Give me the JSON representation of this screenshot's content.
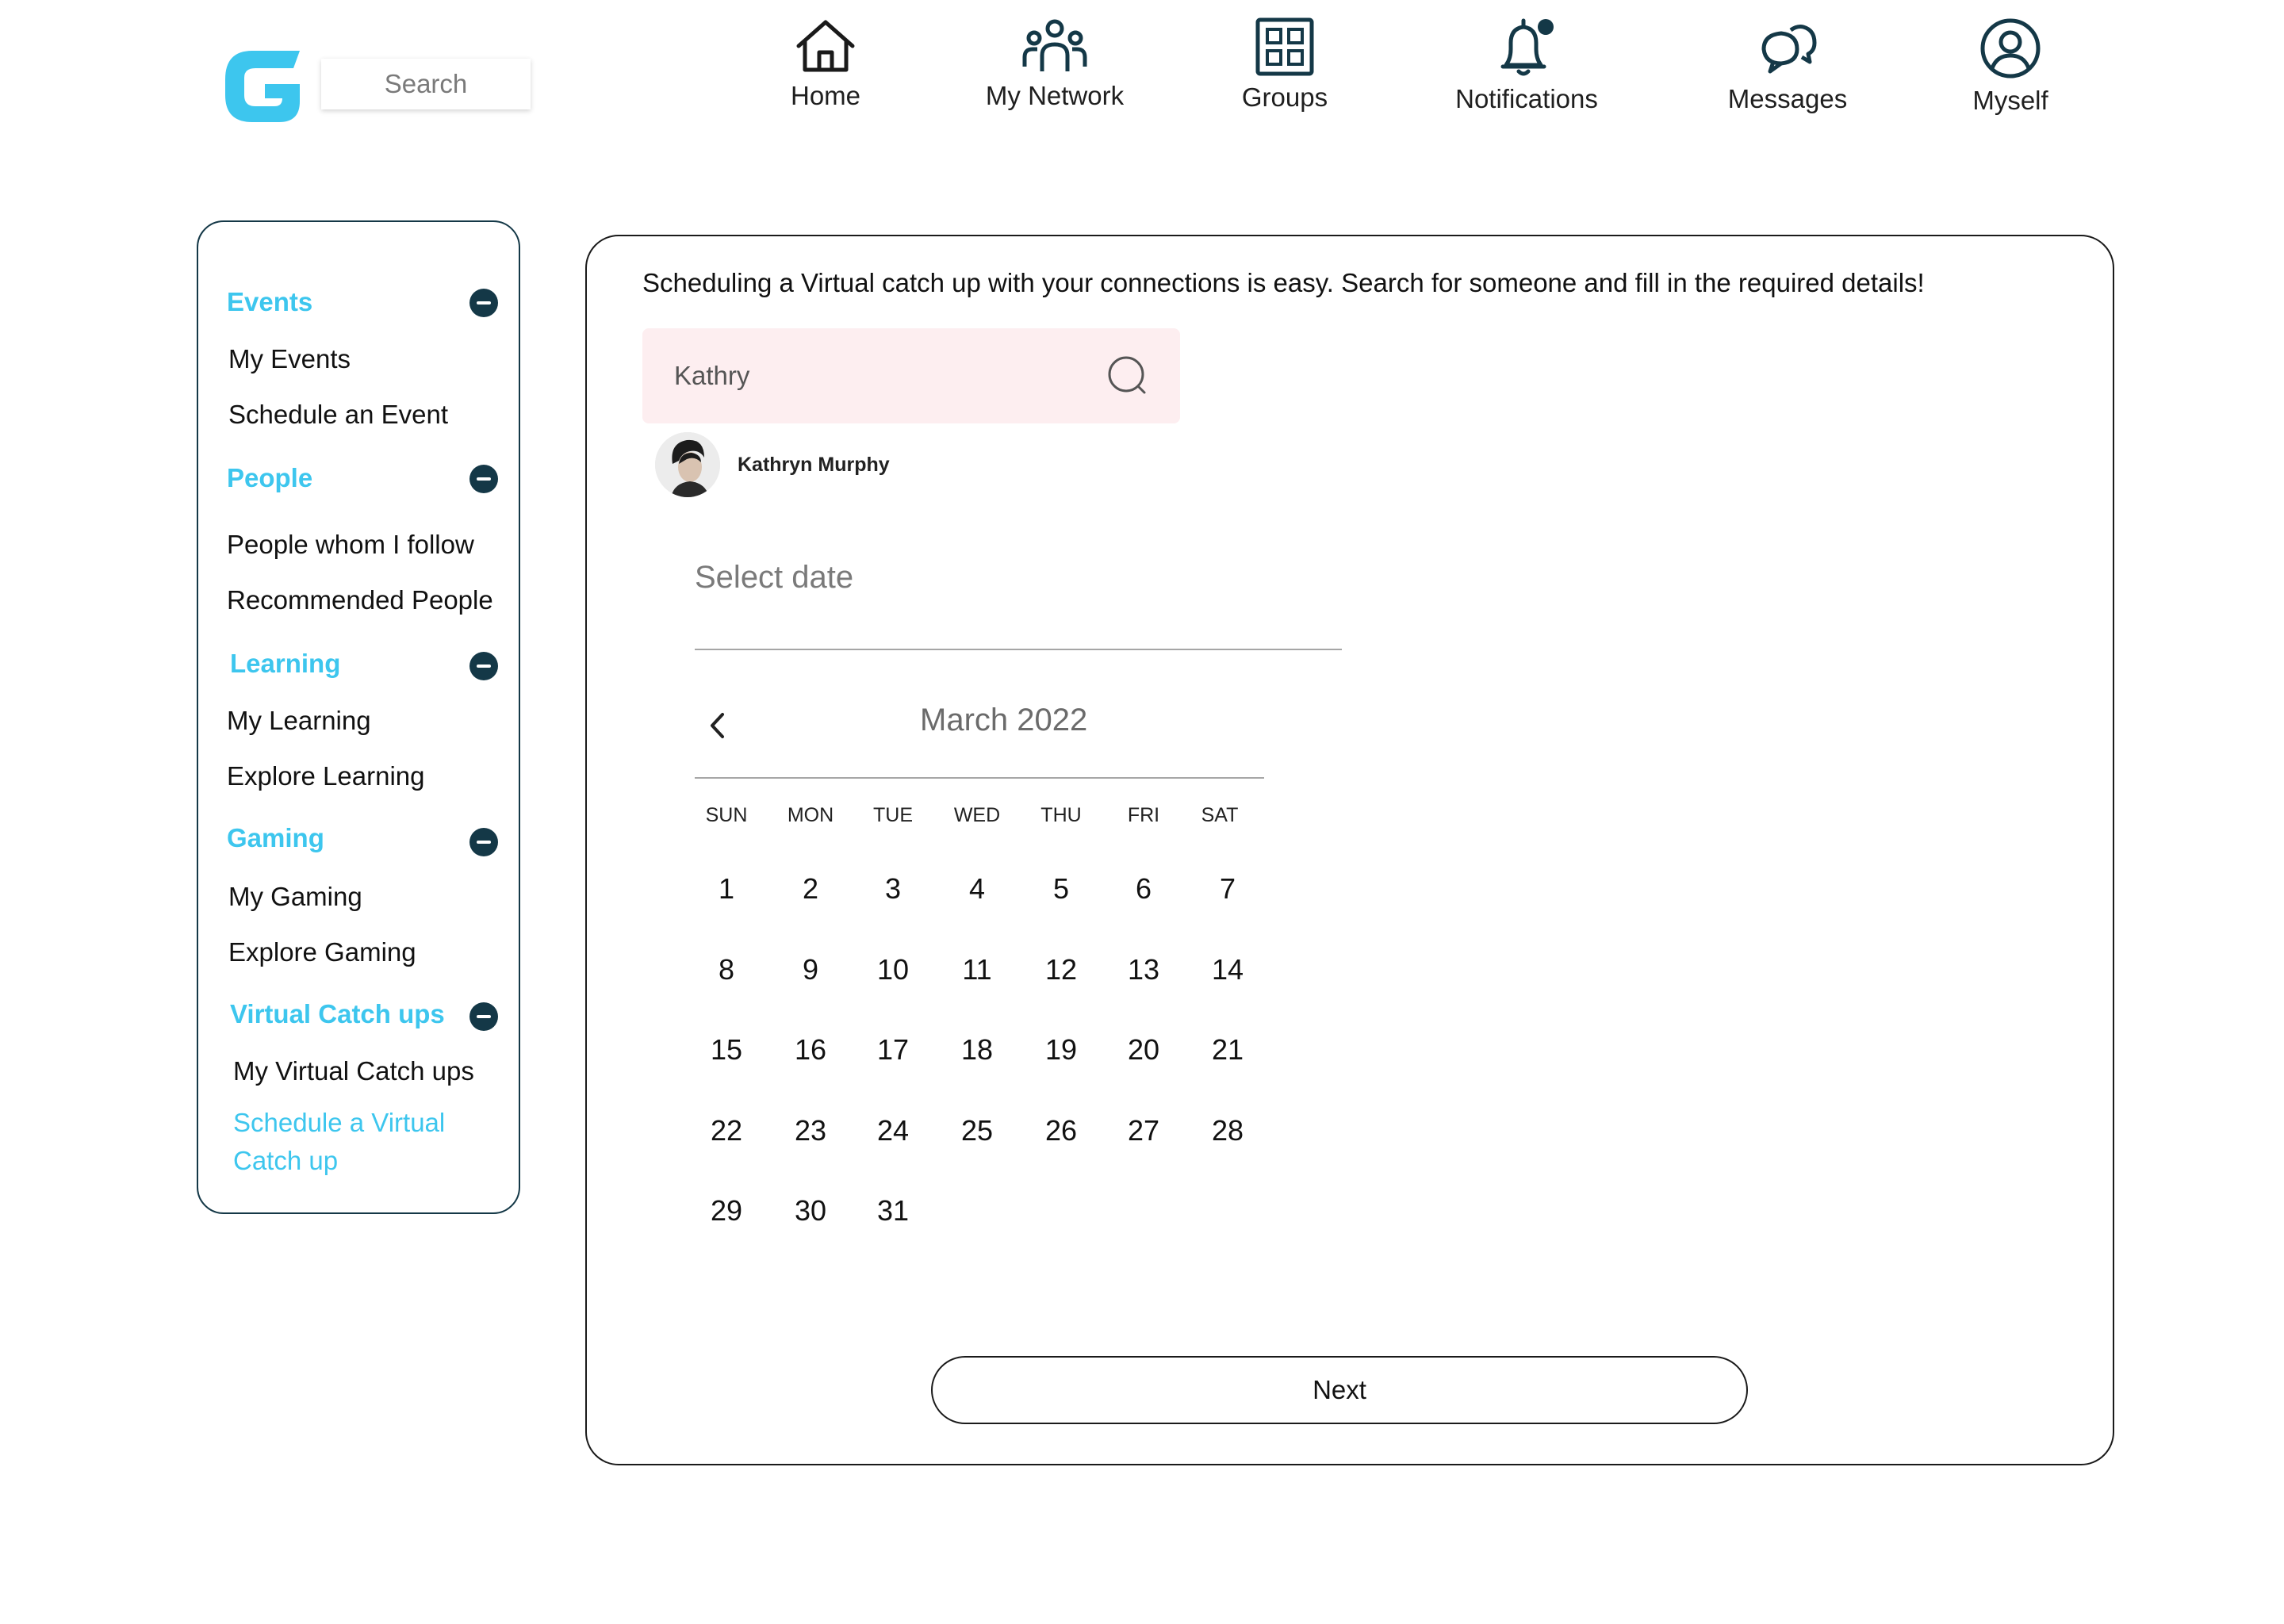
{
  "header": {
    "logo_letter": "G",
    "search_placeholder": "Search",
    "nav": [
      {
        "label": "Home",
        "icon": "home-icon"
      },
      {
        "label": "My Network",
        "icon": "network-icon"
      },
      {
        "label": "Groups",
        "icon": "groups-icon"
      },
      {
        "label": "Notifications",
        "icon": "bell-icon"
      },
      {
        "label": "Messages",
        "icon": "messages-icon"
      },
      {
        "label": "Myself",
        "icon": "profile-icon"
      }
    ]
  },
  "sidebar": {
    "sections": [
      {
        "title": "Events",
        "items": [
          "My Events",
          "Schedule an Event"
        ]
      },
      {
        "title": "People",
        "items": [
          "People whom I follow",
          "Recommended People"
        ]
      },
      {
        "title": "Learning",
        "items": [
          "My Learning",
          "Explore Learning"
        ]
      },
      {
        "title": "Gaming",
        "items": [
          "My Gaming",
          "Explore Gaming"
        ]
      },
      {
        "title": "Virtual Catch ups",
        "items": [
          "My Virtual Catch ups",
          "Schedule a Virtual Catch up"
        ]
      }
    ],
    "active_item": "Schedule a Virtual Catch up"
  },
  "main": {
    "intro": "Scheduling a Virtual catch up with your connections is easy. Search for someone and fill in the required details!",
    "person_search_value": "Kathry",
    "result_name": "Kathryn Murphy",
    "date_label": "Select date",
    "calendar": {
      "month": "March 2022",
      "weekdays": [
        "SUN",
        "MON",
        "TUE",
        "WED",
        "THU",
        "FRI",
        "SAT"
      ],
      "weeks": [
        [
          "1",
          "2",
          "3",
          "4",
          "5",
          "6",
          "7"
        ],
        [
          "8",
          "9",
          "10",
          "11",
          "12",
          "13",
          "14"
        ],
        [
          "15",
          "16",
          "17",
          "18",
          "19",
          "20",
          "21"
        ],
        [
          "22",
          "23",
          "24",
          "25",
          "26",
          "27",
          "28"
        ],
        [
          "29",
          "30",
          "31"
        ]
      ]
    },
    "next_label": "Next"
  },
  "colors": {
    "accent": "#3dc6ee",
    "dark": "#143847",
    "search_bg": "#fdeef0"
  }
}
